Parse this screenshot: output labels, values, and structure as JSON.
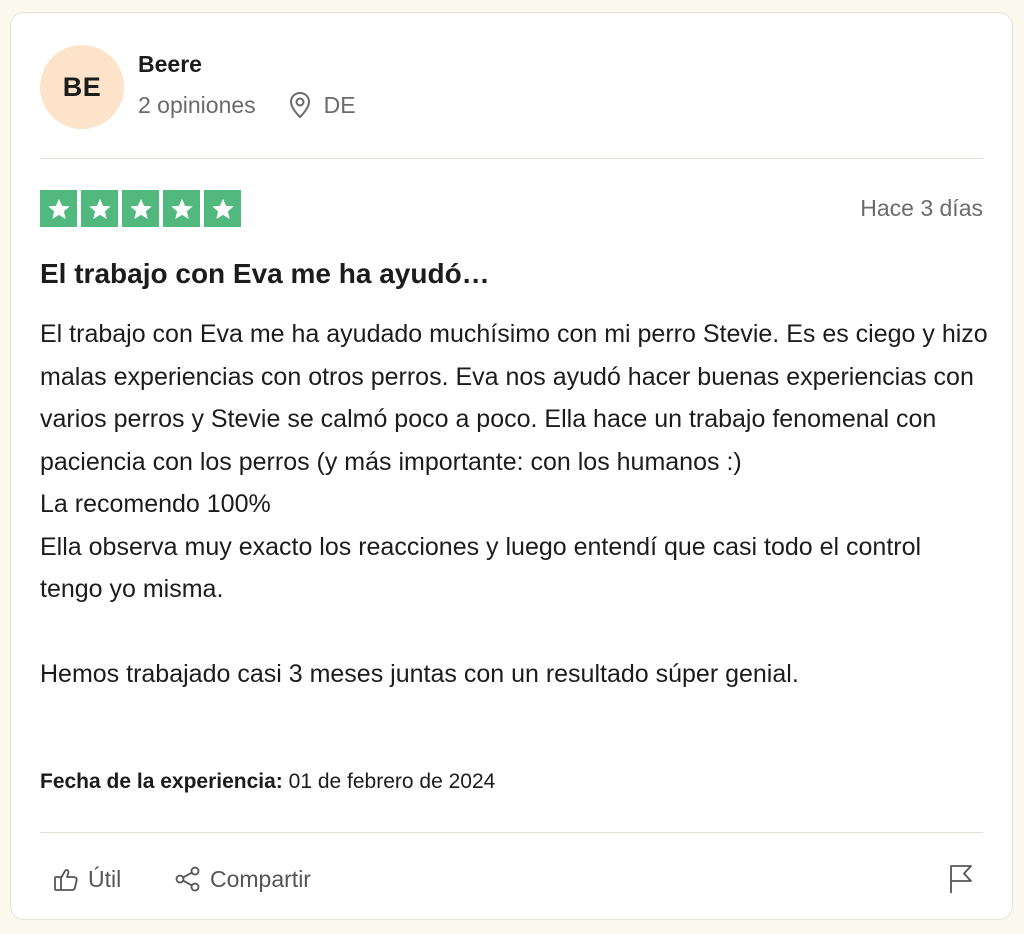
{
  "reviewer": {
    "initials": "BE",
    "name": "Beere",
    "review_count": "2 opiniones",
    "country": "DE",
    "avatar_color": "#fde3c9"
  },
  "review": {
    "rating": 5,
    "rating_color": "#51b97d",
    "date": "Hace 3 días",
    "title": "El trabajo con Eva me ha ayudó…",
    "body": "El trabajo con Eva me ha ayudado muchísimo con mi perro Stevie. Es es ciego y hizo malas experiencias con otros perros. Eva nos ayudó hacer buenas experiencias con varios perros y Stevie se calmó poco a poco. Ella hace un trabajo fenomenal con paciencia con los perros (y más importante: con los humanos :)\nLa recomendo 100%\nElla observa muy exacto los reacciones y luego entendí que casi todo el control tengo yo misma.\n\nHemos trabajado casi 3 meses juntas con un resultado súper genial.",
    "experience_label": "Fecha de la experiencia:",
    "experience_date": "01 de febrero de 2024"
  },
  "actions": {
    "useful_label": "Útil",
    "share_label": "Compartir",
    "useful_icon": "thumbs-up-icon",
    "share_icon": "share-icon",
    "flag_icon": "flag-icon"
  }
}
